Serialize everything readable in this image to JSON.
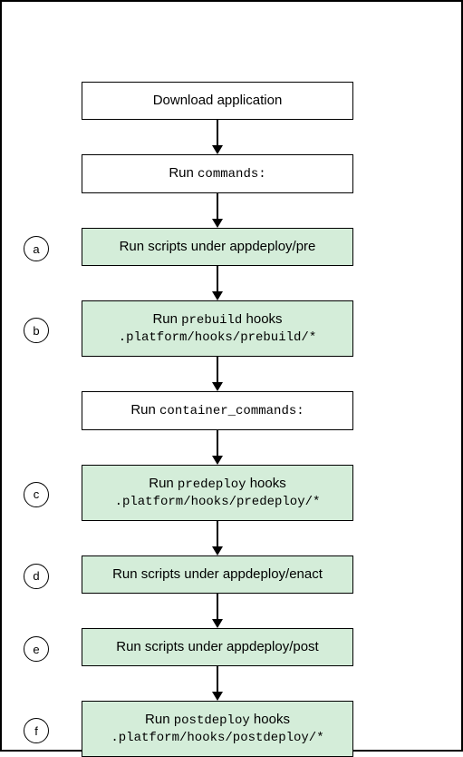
{
  "steps": [
    {
      "style": "white",
      "l1": "Download application"
    },
    {
      "style": "white",
      "l1": "Run ",
      "c1": "commands:"
    },
    {
      "marker": "a",
      "style": "green",
      "l1": "Run scripts under appdeploy/pre"
    },
    {
      "marker": "b",
      "style": "green",
      "l1": "Run ",
      "c1": "prebuild",
      "t1": " hooks",
      "l2": ".platform/hooks/prebuild/*",
      "l2mono": true
    },
    {
      "style": "white",
      "l1": "Run ",
      "c1": "container_commands:"
    },
    {
      "marker": "c",
      "style": "green",
      "l1": "Run ",
      "c1": "predeploy",
      "t1": " hooks",
      "l2": ".platform/hooks/predeploy/*",
      "l2mono": true
    },
    {
      "marker": "d",
      "style": "green",
      "l1": "Run scripts under appdeploy/enact"
    },
    {
      "marker": "e",
      "style": "green",
      "l1": "Run scripts under appdeploy/post"
    },
    {
      "marker": "f",
      "style": "green",
      "l1": "Run ",
      "c1": "postdeploy",
      "t1": " hooks",
      "l2": ".platform/hooks/postdeploy/*",
      "l2mono": true
    }
  ]
}
